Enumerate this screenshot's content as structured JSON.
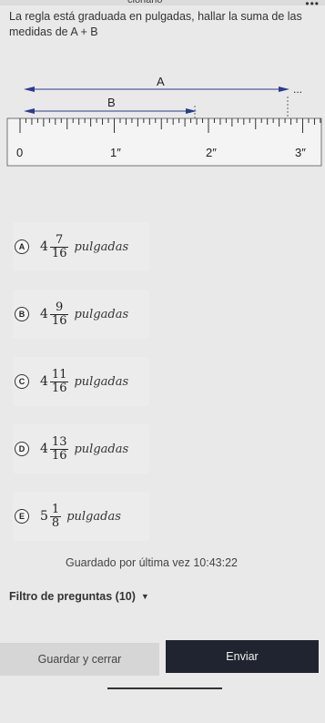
{
  "top": {
    "cut_text": "cionario",
    "dots": "•••"
  },
  "question": {
    "text": "La regla está graduada en pulgadas, hallar la suma de las medidas de A + B"
  },
  "figure": {
    "label_a": "A",
    "label_b": "B",
    "ellipsis": "...",
    "ruler_labels": [
      "0",
      "1″",
      "2″",
      "3″"
    ]
  },
  "choices": [
    {
      "letter": "A",
      "whole": "4",
      "num": "7",
      "den": "16",
      "unit": "pulgadas"
    },
    {
      "letter": "B",
      "whole": "4",
      "num": "9",
      "den": "16",
      "unit": "pulgadas"
    },
    {
      "letter": "C",
      "whole": "4",
      "num": "11",
      "den": "16",
      "unit": "pulgadas"
    },
    {
      "letter": "D",
      "whole": "4",
      "num": "13",
      "den": "16",
      "unit": "pulgadas"
    },
    {
      "letter": "E",
      "whole": "5",
      "num": "1",
      "den": "8",
      "unit": "pulgadas"
    }
  ],
  "saved": {
    "text": "Guardado por última vez 10:43:22"
  },
  "filter": {
    "label": "Filtro de preguntas (10)",
    "icon": "caret-down-icon"
  },
  "buttons": {
    "save_close": "Guardar y cerrar",
    "send": "Enviar"
  },
  "colors": {
    "send_bg": "#1f2430",
    "save_bg": "#d6d6d6",
    "page_bg": "#e9e9e9"
  }
}
